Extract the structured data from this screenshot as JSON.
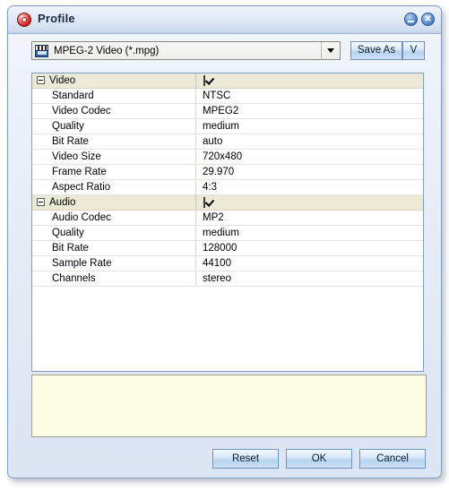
{
  "window": {
    "title": "Profile",
    "icon": "gear-icon",
    "controls": [
      {
        "name": "minimize",
        "glyph": "minimize-icon"
      },
      {
        "name": "close",
        "glyph": "close-icon"
      }
    ]
  },
  "toolbar": {
    "profile_select": {
      "icon": "film-clapper-icon",
      "value": "MPEG-2 Video (*.mpg)",
      "arrow": "chevron-down-icon",
      "options": [
        "MPEG-2 Video (*.mpg)"
      ]
    },
    "save_as_label": "Save As",
    "v_label": "V"
  },
  "grid": {
    "sections": [
      {
        "label": "Video",
        "expanded": true,
        "checked": true,
        "rows": [
          {
            "name": "Standard",
            "value": "NTSC"
          },
          {
            "name": "Video Codec",
            "value": "MPEG2"
          },
          {
            "name": "Quality",
            "value": "medium"
          },
          {
            "name": "Bit Rate",
            "value": "auto"
          },
          {
            "name": "Video Size",
            "value": "720x480"
          },
          {
            "name": "Frame Rate",
            "value": "29.970"
          },
          {
            "name": "Aspect Ratio",
            "value": "4:3"
          }
        ]
      },
      {
        "label": "Audio",
        "expanded": true,
        "checked": true,
        "rows": [
          {
            "name": "Audio Codec",
            "value": "MP2"
          },
          {
            "name": "Quality",
            "value": "medium"
          },
          {
            "name": "Bit Rate",
            "value": "128000"
          },
          {
            "name": "Sample Rate",
            "value": "44100"
          },
          {
            "name": "Channels",
            "value": "stereo"
          }
        ]
      }
    ]
  },
  "description_panel": {
    "text": ""
  },
  "buttons": {
    "reset": "Reset",
    "ok": "OK",
    "cancel": "Cancel"
  },
  "colors": {
    "titlebar_accent": "#c2d2ea",
    "window_border": "#7f9ec4",
    "section_row": "#ece9d8",
    "description_bg": "#fdfde4",
    "button_face": "#b7d3f0"
  }
}
